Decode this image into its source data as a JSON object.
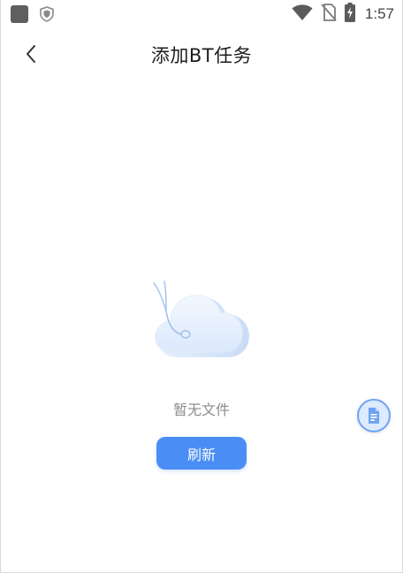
{
  "status_bar": {
    "time": "1:57",
    "icons": [
      "app-square-icon",
      "shield-icon",
      "wifi-icon",
      "no-sim-icon",
      "battery-charging-icon"
    ]
  },
  "header": {
    "title": "添加BT任务",
    "back_icon": "chevron-left-icon"
  },
  "empty_state": {
    "illustration": "cloud-icon",
    "message": "暂无文件",
    "refresh_label": "刷新"
  },
  "floating_button": {
    "icon": "document-icon"
  },
  "colors": {
    "accent": "#4a8df5",
    "empty_text": "#8c8c8c",
    "title_text": "#1c1c1c",
    "float_bg": "#dcebfd"
  }
}
